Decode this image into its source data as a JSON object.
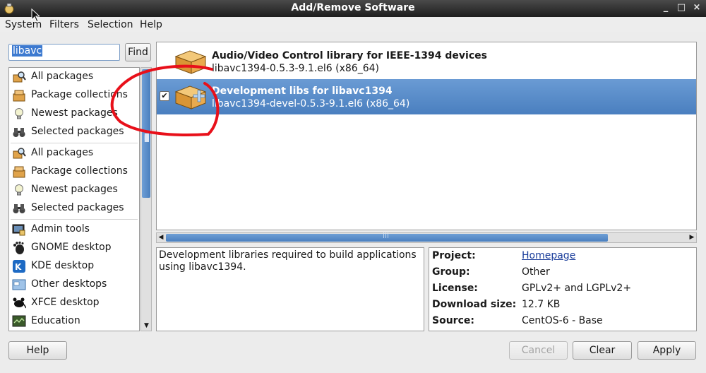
{
  "window": {
    "title": "Add/Remove Software",
    "controls": {
      "minimize": "_",
      "maximize": "□",
      "close": "×"
    }
  },
  "menu": [
    "System",
    "Filters",
    "Selection",
    "Help"
  ],
  "search": {
    "value": "libavc",
    "find_label": "Find"
  },
  "sidebar": {
    "groups": [
      [
        {
          "label": "All packages",
          "icon": "search-package-icon"
        },
        {
          "label": "Package collections",
          "icon": "package-collection-icon"
        },
        {
          "label": "Newest packages",
          "icon": "lightbulb-icon"
        },
        {
          "label": "Selected packages",
          "icon": "binoculars-icon"
        }
      ],
      [
        {
          "label": "All packages",
          "icon": "search-package-icon"
        },
        {
          "label": "Package collections",
          "icon": "package-collection-icon"
        },
        {
          "label": "Newest packages",
          "icon": "lightbulb-icon"
        },
        {
          "label": "Selected packages",
          "icon": "binoculars-icon"
        }
      ],
      [
        {
          "label": "Admin tools",
          "icon": "admin-tools-icon"
        },
        {
          "label": "GNOME desktop",
          "icon": "gnome-foot-icon"
        },
        {
          "label": "KDE desktop",
          "icon": "kde-gear-icon"
        },
        {
          "label": "Other desktops",
          "icon": "other-desktops-icon"
        },
        {
          "label": "XFCE desktop",
          "icon": "xfce-mouse-icon"
        },
        {
          "label": "Education",
          "icon": "education-icon"
        }
      ]
    ]
  },
  "packages": [
    {
      "name": "Audio/Video Control library for IEEE-1394 devices",
      "version": "libavc1394-0.5.3-9.1.el6 (x86_64)",
      "checked": false,
      "icon": "package-box-icon"
    },
    {
      "name": "Development libs for libavc1394",
      "version": "libavc1394-devel-0.5.3-9.1.el6 (x86_64)",
      "checked": true,
      "icon": "package-install-icon"
    }
  ],
  "description": "Development libraries required to build applications using libavc1394.",
  "details": [
    {
      "key": "Project:",
      "value": "Homepage",
      "link": true
    },
    {
      "key": "Group:",
      "value": "Other"
    },
    {
      "key": "License:",
      "value": "GPLv2+ and LGPLv2+"
    },
    {
      "key": "Download size:",
      "value": "12.7 KB"
    },
    {
      "key": "Source:",
      "value": "CentOS-6 - Base"
    }
  ],
  "buttons": {
    "help": "Help",
    "cancel": "Cancel",
    "clear": "Clear",
    "apply": "Apply"
  },
  "colors": {
    "selection": "#4a7fbf",
    "annotation": "#e8101a"
  }
}
